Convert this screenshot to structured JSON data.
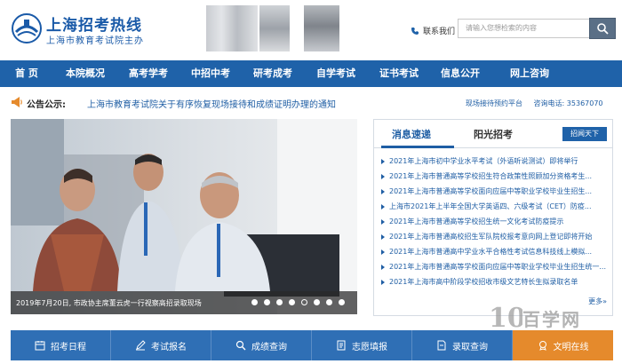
{
  "header": {
    "logo_title": "上海招考热线",
    "logo_subtitle": "上海市教育考试院主办",
    "contact_label": "联系我们",
    "search_placeholder": "请输入您想检索的内容"
  },
  "nav": {
    "items": [
      "首 页",
      "本院概况",
      "高考学考",
      "中招中考",
      "研考成考",
      "自学考试",
      "证书考试",
      "信息公开",
      "网上咨询"
    ]
  },
  "notice": {
    "label": "公告公示:",
    "text": "上海市教育考试院关于有序恢复现场接待和成绩证明办理的通知",
    "reservation": "现场接待预约平台",
    "phone_label": "咨询电话:",
    "phone": "35367070"
  },
  "slider": {
    "caption": "2019年7月20日, 市政协主席董云虎一行视察高招录取现场",
    "dot_count": 8,
    "active_dot": 4
  },
  "news": {
    "tab_active": "消息速递",
    "tab_other": "阳光招考",
    "button": "招闻天下",
    "items": [
      "2021年上海市初中学业水平考试（外语听说测试）即将举行",
      "2021年上海市普通高等学校招生符合政策性照顾加分资格考生...",
      "2021年上海市普通高等学校面向应届中等职业学校毕业生招生...",
      "上海市2021年上半年全国大学英语四、六级考试（CET）防疫...",
      "2021年上海市普通高等学校招生统一文化考试防疫提示",
      "2021年上海市普通高校招生军队院校报考意向网上登记即将开始",
      "2021年上海市普通高中学业水平合格性考试信息科技线上模拟...",
      "2021年上海市普通高等学校面向应届中等职业学校毕业生招生统一...",
      "2021年上海市高中阶段学校招收市级文艺特长生拟录取名单"
    ],
    "more": "更多»"
  },
  "watermark": {
    "text": "百学网"
  },
  "bottom_bar": {
    "items": [
      {
        "label": "招考日程",
        "icon": "calendar-icon"
      },
      {
        "label": "考试报名",
        "icon": "pencil-icon"
      },
      {
        "label": "成绩查询",
        "icon": "search-icon"
      },
      {
        "label": "志愿填报",
        "icon": "form-icon"
      },
      {
        "label": "录取查询",
        "icon": "document-icon"
      },
      {
        "label": "文明在线",
        "icon": "badge-icon"
      }
    ]
  },
  "colors": {
    "primary": "#1f62a9",
    "link": "#1f5ea4",
    "accent": "#e58a2c"
  }
}
